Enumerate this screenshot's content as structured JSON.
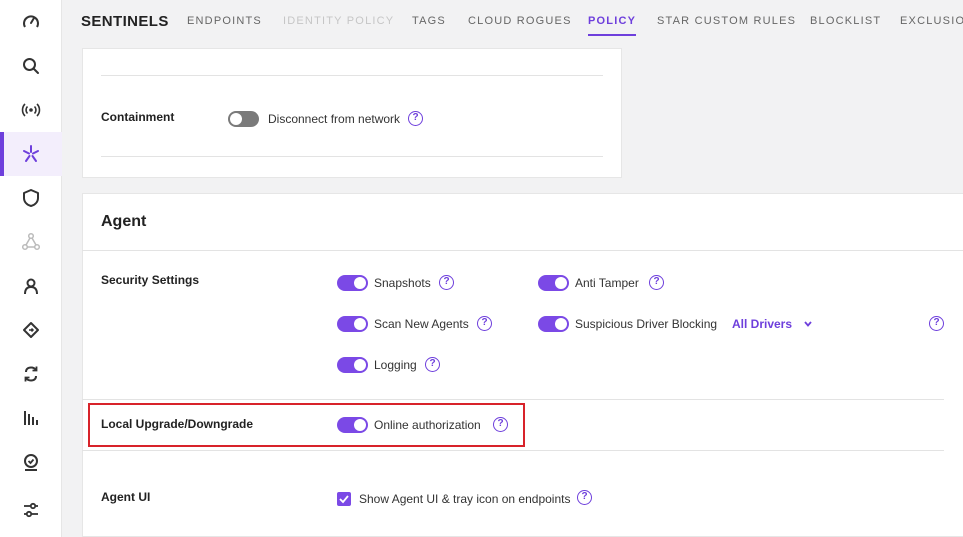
{
  "colors": {
    "accent": "#6e3fdc",
    "toggle_on": "#7b49e6",
    "toggle_off": "#7a7a7a",
    "highlight": "#d8232a"
  },
  "sidebar": {
    "items": [
      {
        "icon": "dashboard-gauge-icon",
        "active": false
      },
      {
        "icon": "search-icon",
        "active": false
      },
      {
        "icon": "broadcast-icon",
        "active": false
      },
      {
        "icon": "sentinels-star-icon",
        "active": true
      },
      {
        "icon": "shield-icon",
        "active": false
      },
      {
        "icon": "network-graph-icon",
        "active": false
      },
      {
        "icon": "user-icon",
        "active": false
      },
      {
        "icon": "diamond-arrow-icon",
        "active": false
      },
      {
        "icon": "sync-arrows-icon",
        "active": false
      },
      {
        "icon": "bar-chart-icon",
        "active": false
      },
      {
        "icon": "automation-badge-icon",
        "active": false
      },
      {
        "icon": "sliders-icon",
        "active": false
      }
    ]
  },
  "topnav": {
    "brand": "SENTINELS",
    "tabs": [
      {
        "label": "ENDPOINTS",
        "state": "normal"
      },
      {
        "label": "IDENTITY POLICY",
        "state": "disabled"
      },
      {
        "label": "TAGS",
        "state": "normal"
      },
      {
        "label": "CLOUD ROGUES",
        "state": "normal"
      },
      {
        "label": "POLICY",
        "state": "active"
      },
      {
        "label": "STAR CUSTOM RULES",
        "state": "normal"
      },
      {
        "label": "BLOCKLIST",
        "state": "normal"
      },
      {
        "label": "EXCLUSIONS",
        "state": "normal"
      }
    ]
  },
  "containment": {
    "label": "Containment",
    "option": {
      "text": "Disconnect from network",
      "enabled": false
    }
  },
  "agent": {
    "title": "Agent",
    "security_settings": {
      "label": "Security Settings",
      "snapshots": {
        "text": "Snapshots",
        "enabled": true
      },
      "anti_tamper": {
        "text": "Anti Tamper",
        "enabled": true
      },
      "scan_new_agents": {
        "text": "Scan New Agents",
        "enabled": true
      },
      "suspicious_driver_blocking": {
        "text": "Suspicious Driver Blocking",
        "enabled": true,
        "selected": "All Drivers"
      },
      "logging": {
        "text": "Logging",
        "enabled": true
      }
    },
    "local_upgrade": {
      "label": "Local Upgrade/Downgrade",
      "option": {
        "text": "Online authorization",
        "enabled": true
      }
    },
    "agent_ui": {
      "label": "Agent UI",
      "option": {
        "text": "Show Agent UI & tray icon on endpoints",
        "checked": true
      }
    }
  },
  "help_glyph": "?"
}
